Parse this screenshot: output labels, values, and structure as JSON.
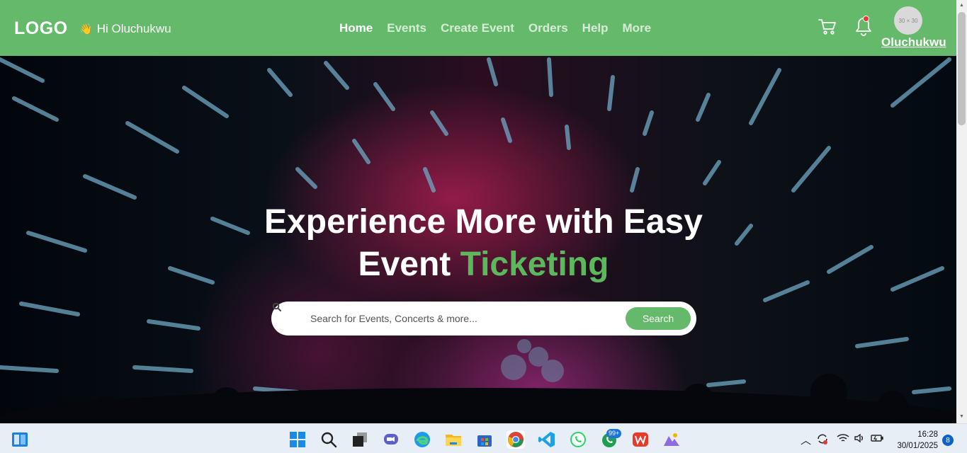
{
  "header": {
    "logo": "LOGO",
    "greeting_emoji": "👋",
    "greeting": "Hi Oluchukwu",
    "nav": [
      "Home",
      "Events",
      "Create Event",
      "Orders",
      "Help",
      "More"
    ],
    "active_nav": "Home",
    "avatar_placeholder": "30 × 30",
    "username": "Oluchukwu"
  },
  "hero": {
    "headline_line1": "Experience More with Easy",
    "headline_line2_plain": "Event",
    "headline_line2_accent": "Ticketing",
    "search_placeholder": "Search for Events, Concerts & more...",
    "search_button": "Search"
  },
  "colors": {
    "brand_green": "#65b96a",
    "accent_text": "#5cb85c",
    "notification_dot": "#e53935"
  },
  "taskbar": {
    "apps": [
      "widgets",
      "start",
      "search",
      "task-view",
      "chat",
      "edge",
      "file-explorer",
      "store",
      "chrome",
      "vscode",
      "whatsapp",
      "whatsapp-beta",
      "wps-office",
      "photos"
    ],
    "whatsapp_badge": "99+",
    "time": "16:28",
    "date": "30/01/2025",
    "notification_count": "8"
  }
}
